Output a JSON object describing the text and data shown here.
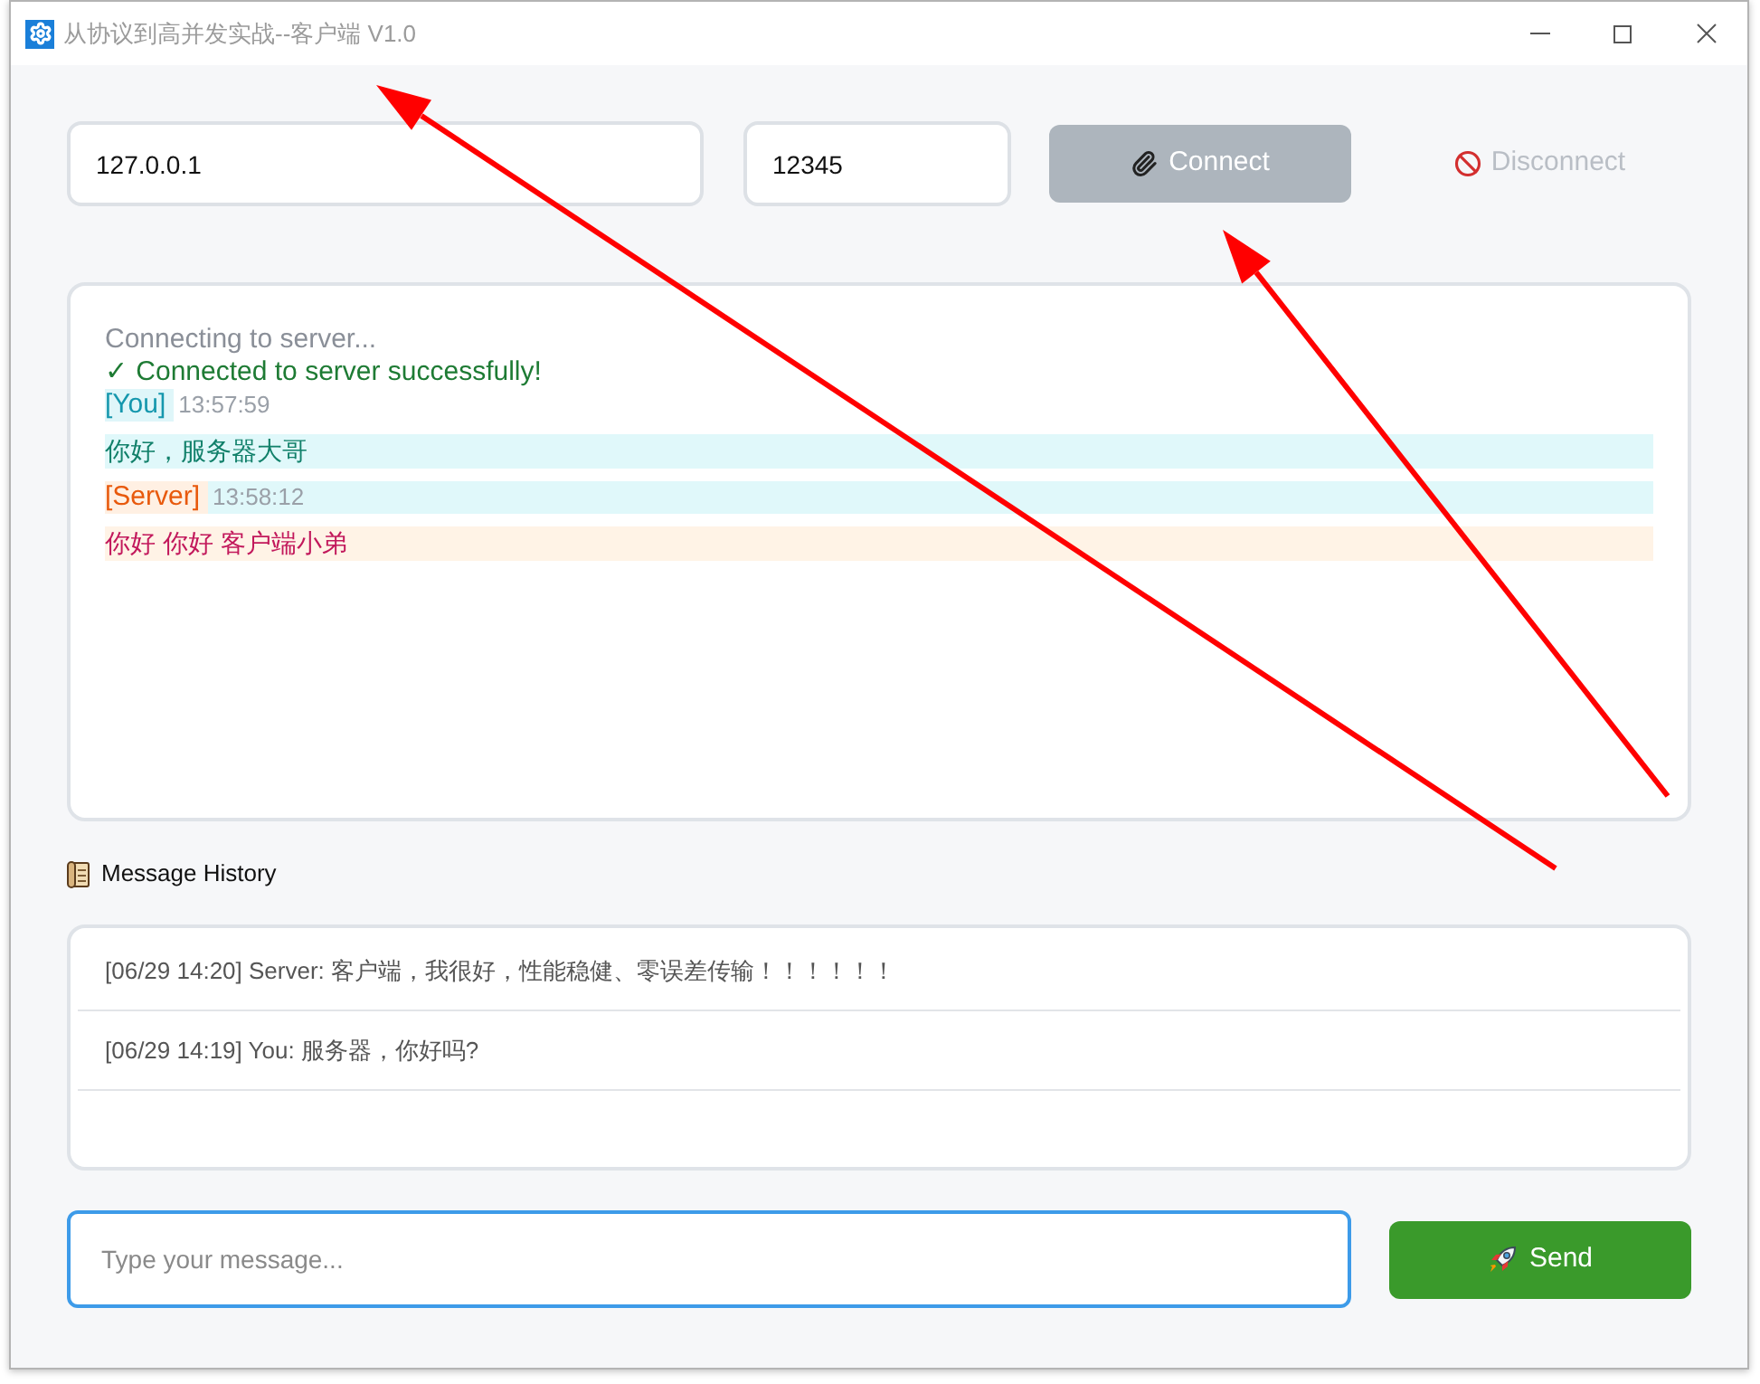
{
  "window": {
    "title": "从协议到高并发实战--客户端 V1.0"
  },
  "connection": {
    "host": "127.0.0.1",
    "port": "12345",
    "connect_button": {
      "label": "Connect",
      "disabled": true
    },
    "disconnect_button": {
      "label": "Disconnect"
    }
  },
  "log": {
    "lines": [
      {
        "kind": "status",
        "text": "Connecting to server..."
      },
      {
        "kind": "success",
        "text": "✓ Connected to server successfully!"
      }
    ],
    "messages": [
      {
        "kind": "outgoing",
        "sender": "[You]",
        "time": "13:57:59",
        "text": "你好，服务器大哥"
      },
      {
        "kind": "incoming",
        "sender": "[Server]",
        "time": "13:58:12",
        "text": "你好 你好 客户端小弟"
      }
    ]
  },
  "history": {
    "title": "Message History",
    "items": [
      "[06/29 14:20] Server: 客户端，我很好，性能稳健、零误差传输！！！！！！",
      "[06/29 14:19] You: 服务器，你好吗?"
    ]
  },
  "composer": {
    "placeholder": "Type your message...",
    "focused": true,
    "send_label": "Send"
  }
}
